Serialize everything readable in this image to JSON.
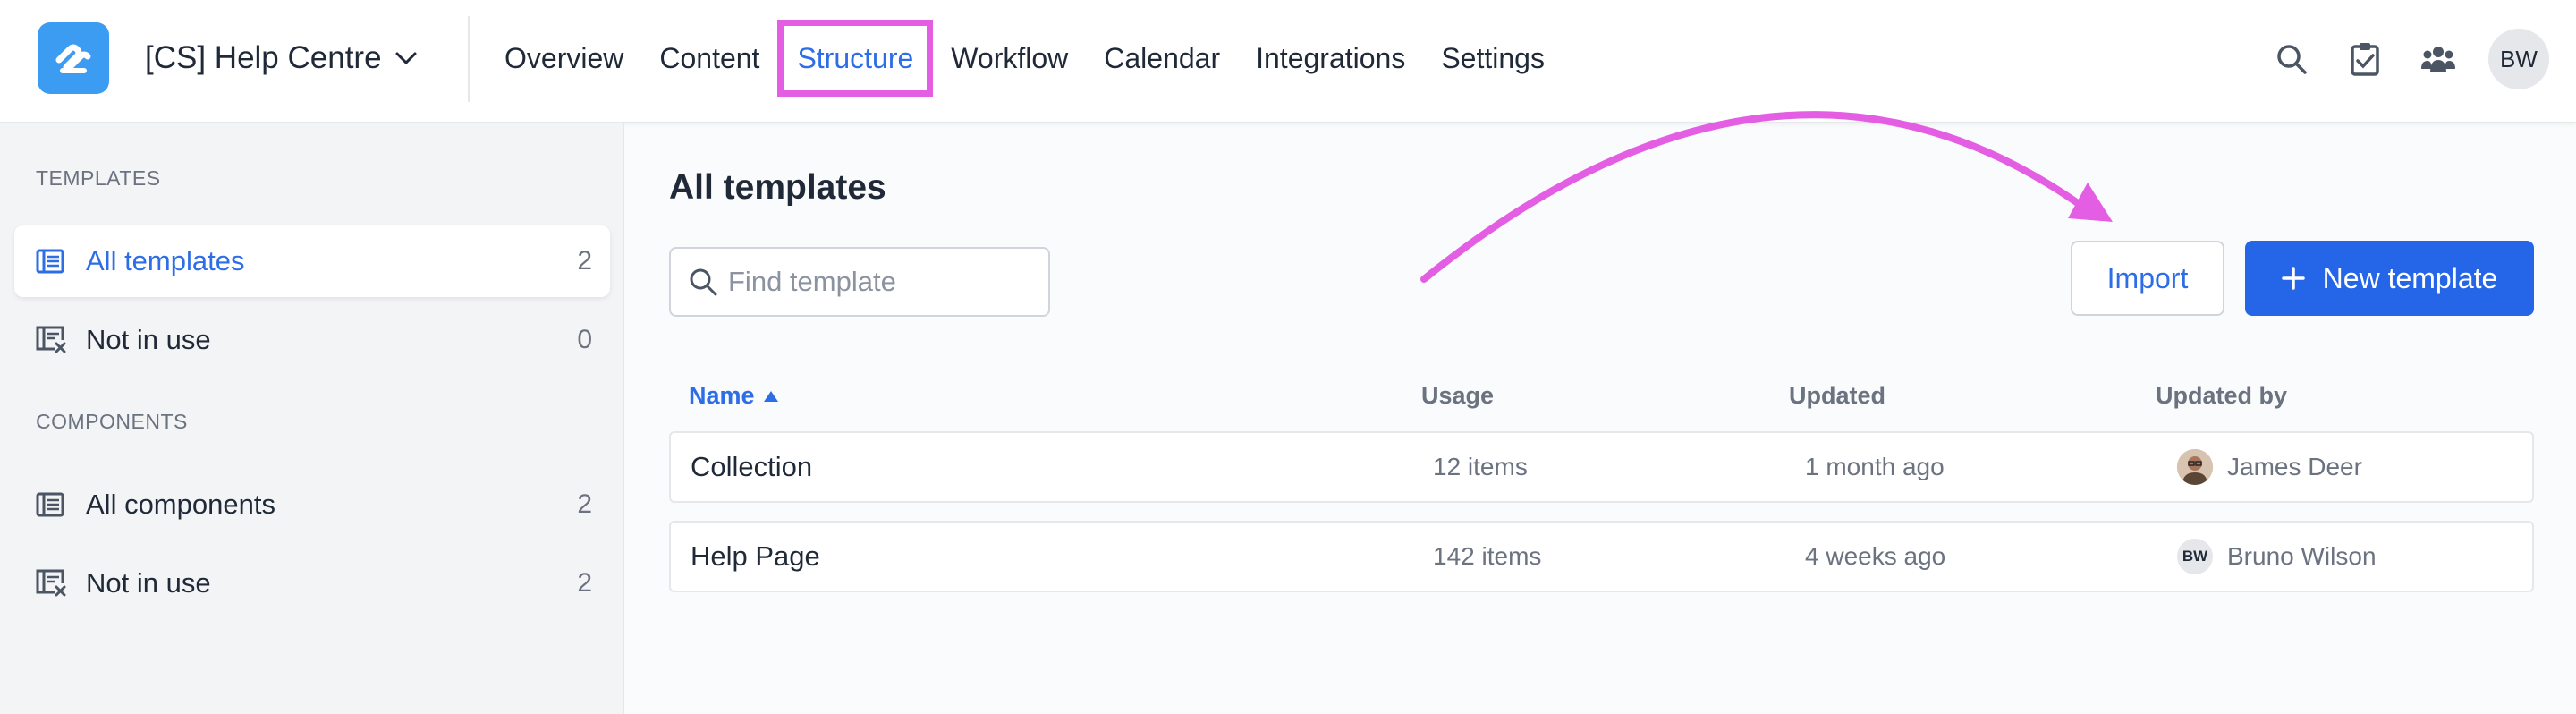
{
  "header": {
    "project_name": "[CS] Help Centre",
    "nav": [
      "Overview",
      "Content",
      "Structure",
      "Workflow",
      "Calendar",
      "Integrations",
      "Settings"
    ],
    "active_nav": "Structure",
    "user_initials": "BW",
    "icons": [
      "search-icon",
      "tasks-icon",
      "team-icon"
    ]
  },
  "sidebar": {
    "templates_heading": "TEMPLATES",
    "components_heading": "COMPONENTS",
    "templates": [
      {
        "label": "All templates",
        "count": "2",
        "icon": "list-icon",
        "active": true
      },
      {
        "label": "Not in use",
        "count": "0",
        "icon": "list-remove-icon",
        "active": false
      }
    ],
    "components": [
      {
        "label": "All components",
        "count": "2",
        "icon": "list-icon",
        "active": false
      },
      {
        "label": "Not in use",
        "count": "2",
        "icon": "list-remove-icon",
        "active": false
      }
    ]
  },
  "main": {
    "title": "All templates",
    "search_placeholder": "Find template",
    "import_label": "Import",
    "new_template_label": "New template",
    "columns": [
      "Name",
      "Usage",
      "Updated",
      "Updated by"
    ],
    "sorted_column": "Name",
    "sort_direction": "ascending",
    "rows": [
      {
        "name": "Collection",
        "usage": "12 items",
        "updated": "1 month ago",
        "updated_by": "James Deer",
        "avatar_type": "photo"
      },
      {
        "name": "Help Page",
        "usage": "142 items",
        "updated": "4 weeks ago",
        "updated_by": "Bruno Wilson",
        "avatar_type": "initials",
        "avatar_initials": "BW"
      }
    ]
  },
  "colors": {
    "accent": "#2566e8",
    "logo": "#3b9cf2",
    "annotation": "#e35ee3"
  }
}
